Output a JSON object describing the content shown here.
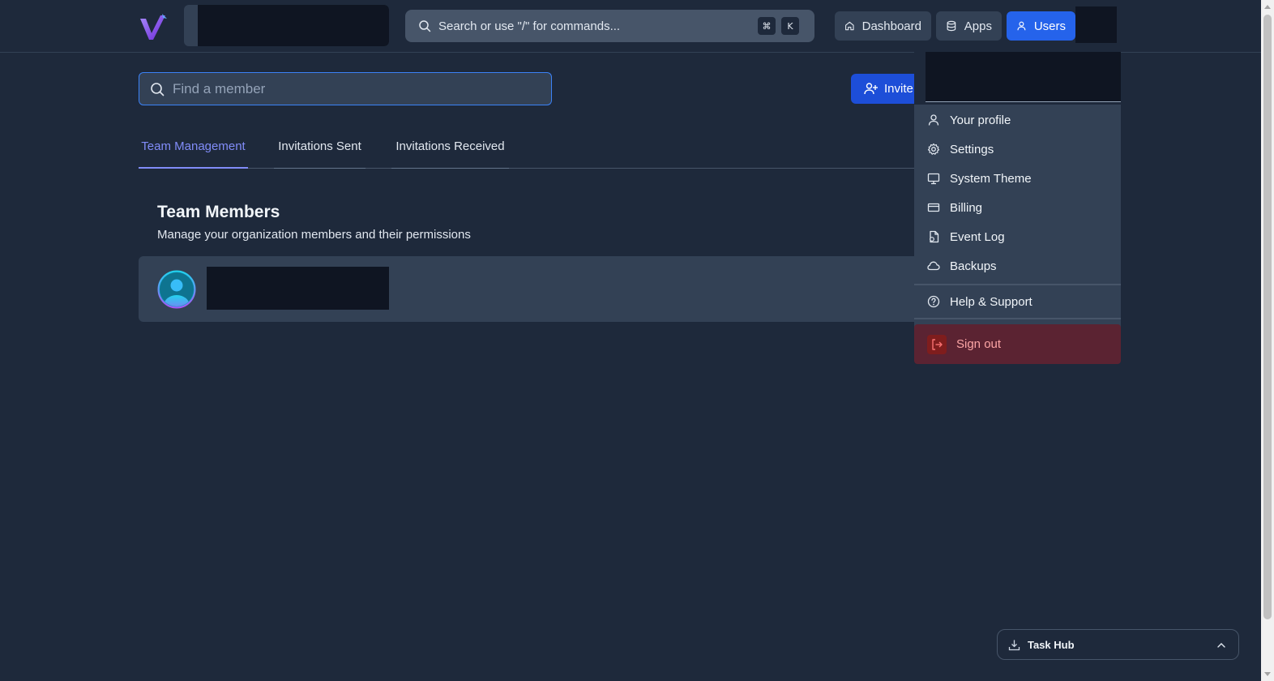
{
  "header": {
    "command_search": {
      "placeholder": "Search or use \"/\" for commands...",
      "kbd_meta": "⌘",
      "kbd_key": "K"
    },
    "nav": [
      {
        "label": "Dashboard",
        "icon": "home-icon"
      },
      {
        "label": "Apps",
        "icon": "database-icon"
      },
      {
        "label": "Users",
        "icon": "user-icon",
        "active": true
      }
    ]
  },
  "main": {
    "member_search": {
      "placeholder": "Find a member"
    },
    "invite_label": "Invite",
    "tabs": [
      {
        "label": "Team Management",
        "active": true
      },
      {
        "label": "Invitations Sent"
      },
      {
        "label": "Invitations Received"
      }
    ],
    "section": {
      "title": "Team Members",
      "subtitle": "Manage your organization members and their permissions"
    }
  },
  "user_menu": {
    "items": [
      {
        "label": "Your profile",
        "icon": "user-icon"
      },
      {
        "label": "Settings",
        "icon": "gear-icon"
      },
      {
        "label": "System Theme",
        "icon": "monitor-icon"
      },
      {
        "label": "Billing",
        "icon": "credit-card-icon"
      },
      {
        "label": "Event Log",
        "icon": "file-log-icon"
      },
      {
        "label": "Backups",
        "icon": "cloud-icon"
      }
    ],
    "help_label": "Help & Support",
    "signout_label": "Sign out"
  },
  "task_hub": {
    "label": "Task Hub"
  },
  "colors": {
    "background": "#1e293b",
    "accent": "#2563eb",
    "tab_active": "#818cf8",
    "danger_bg": "#5b2332",
    "danger_text": "#fca5a5"
  }
}
